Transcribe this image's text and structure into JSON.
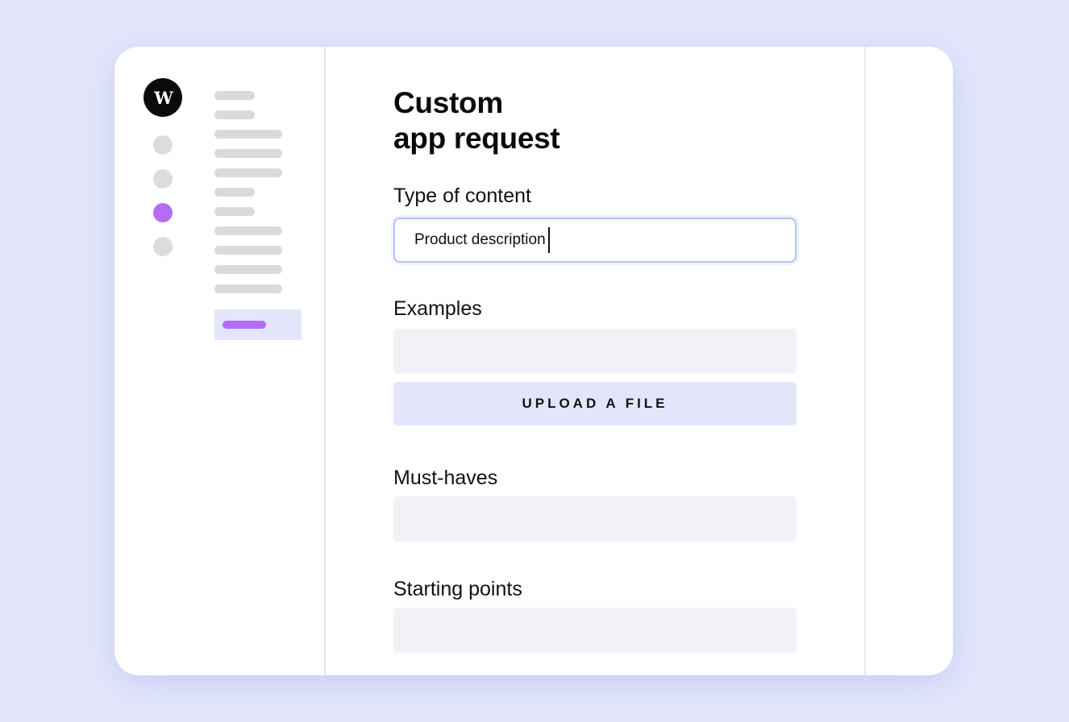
{
  "app": {
    "logo_text": "W"
  },
  "form": {
    "title_line1": "Custom",
    "title_line2": "app request",
    "type_label": "Type of content",
    "type_value": "Product description",
    "examples_label": "Examples",
    "upload_label": "UPLOAD A FILE",
    "musthaves_label": "Must-haves",
    "starting_label": "Starting points"
  },
  "colors": {
    "background": "#e3e6fb",
    "accent": "#b46cf7",
    "field_fill": "#f2f2f6",
    "input_border": "#b4c2f8"
  }
}
